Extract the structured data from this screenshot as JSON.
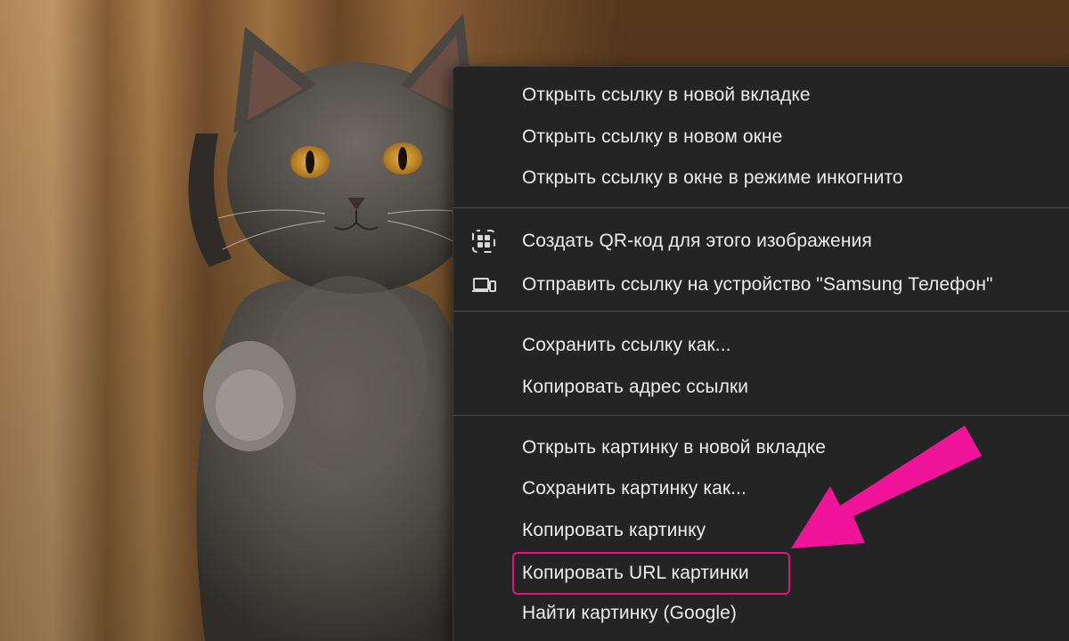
{
  "context_menu": {
    "items": [
      {
        "label": "Открыть ссылку в новой вкладке"
      },
      {
        "label": "Открыть ссылку в новом окне"
      },
      {
        "label": "Открыть ссылку в окне в режиме инкогнито"
      },
      {
        "label": "Создать QR-код для этого изображения",
        "icon": "qr-code-icon"
      },
      {
        "label": "Отправить ссылку на устройство \"Samsung Телефон\"",
        "icon": "send-to-device-icon"
      },
      {
        "label": "Сохранить ссылку как..."
      },
      {
        "label": "Копировать адрес ссылки"
      },
      {
        "label": "Открыть картинку в новой вкладке"
      },
      {
        "label": "Сохранить картинку как..."
      },
      {
        "label": "Копировать картинку"
      },
      {
        "label": "Копировать URL картинки",
        "highlighted": true
      },
      {
        "label": "Найти картинку (Google)"
      }
    ]
  },
  "annotation": {
    "highlight_color": "#e0137f",
    "arrow_color": "#f0149a",
    "target_item": "Копировать URL картинки"
  },
  "colors": {
    "menu_background": "#242424",
    "menu_text": "#ececec",
    "separator": "#4a4a4a"
  }
}
